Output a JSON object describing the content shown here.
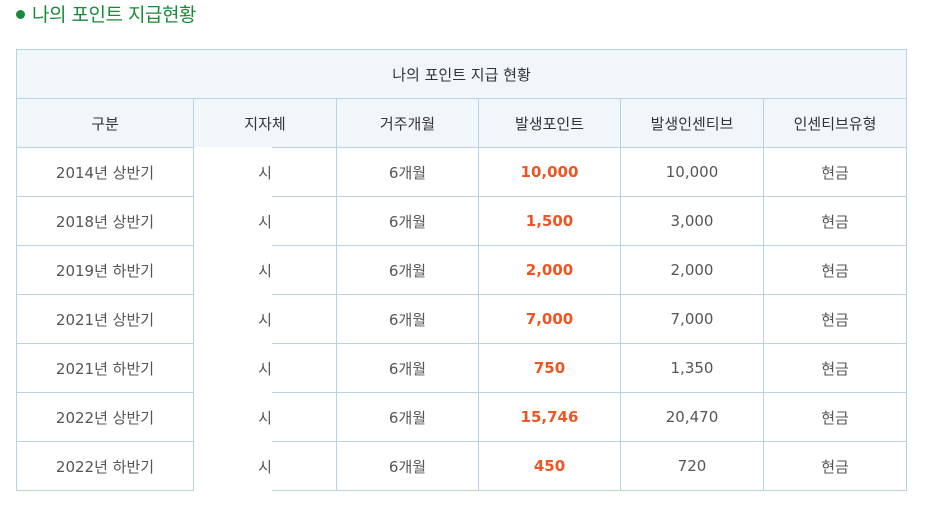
{
  "page": {
    "title": "나의 포인트 지급현황"
  },
  "table": {
    "caption": "나의 포인트 지급 현황",
    "headers": [
      "구분",
      "지자체",
      "거주개월",
      "발생포인트",
      "발생인센티브",
      "인센티브유형"
    ],
    "rows": [
      {
        "period": "2014년 상반기",
        "region": "시",
        "months": "6개월",
        "points": "10,000",
        "incentive": "10,000",
        "type": "현금"
      },
      {
        "period": "2018년 상반기",
        "region": "시",
        "months": "6개월",
        "points": "1,500",
        "incentive": "3,000",
        "type": "현금"
      },
      {
        "period": "2019년 하반기",
        "region": "시",
        "months": "6개월",
        "points": "2,000",
        "incentive": "2,000",
        "type": "현금"
      },
      {
        "period": "2021년 상반기",
        "region": "시",
        "months": "6개월",
        "points": "7,000",
        "incentive": "7,000",
        "type": "현금"
      },
      {
        "period": "2021년 하반기",
        "region": "시",
        "months": "6개월",
        "points": "750",
        "incentive": "1,350",
        "type": "현금"
      },
      {
        "period": "2022년 상반기",
        "region": "시",
        "months": "6개월",
        "points": "15,746",
        "incentive": "20,470",
        "type": "현금"
      },
      {
        "period": "2022년 하반기",
        "region": "시",
        "months": "6개월",
        "points": "450",
        "incentive": "720",
        "type": "현금"
      }
    ]
  },
  "colors": {
    "title_green": "#1a8a3a",
    "points_orange": "#ee5522",
    "border_blue": "#b9d3e3",
    "header_bg": "#f1f6fa"
  }
}
